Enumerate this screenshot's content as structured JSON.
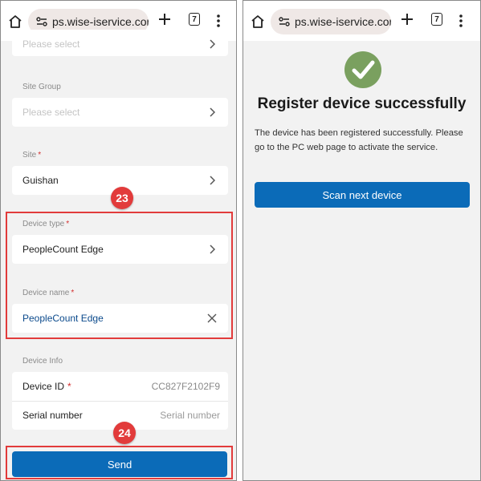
{
  "left_panel": {
    "browser": {
      "url": "ps.wise-iservice.com",
      "tab_count": "7"
    },
    "form": {
      "top_field": {
        "placeholder": "Please select"
      },
      "site_group": {
        "label": "Site Group",
        "placeholder": "Please select"
      },
      "site": {
        "label": "Site",
        "required_mark": "*",
        "value": "Guishan"
      },
      "device_type": {
        "label": "Device type",
        "required_mark": "*",
        "value": "PeopleCount Edge"
      },
      "device_name": {
        "label": "Device name",
        "required_mark": "*",
        "value": "PeopleCount Edge"
      },
      "device_info": {
        "label": "Device Info",
        "device_id_label": "Device ID",
        "device_id_required": "*",
        "device_id_value": "CC827F2102F9",
        "serial_label": "Serial number",
        "serial_placeholder": "Serial number"
      },
      "send_label": "Send"
    },
    "annotations": {
      "step_a": "23",
      "step_b": "24"
    }
  },
  "right_panel": {
    "browser": {
      "url": "ps.wise-iservice.com",
      "tab_count": "7"
    },
    "title": "Register device successfully",
    "message": "The device has been registered successfully. Please go to the PC web page to activate the service.",
    "scan_button_label": "Scan next device"
  },
  "colors": {
    "primary_button": "#0b6bb8",
    "annotation_red": "#e23b3b",
    "success_green": "#7aa05f",
    "required_red": "#d32f2f"
  }
}
